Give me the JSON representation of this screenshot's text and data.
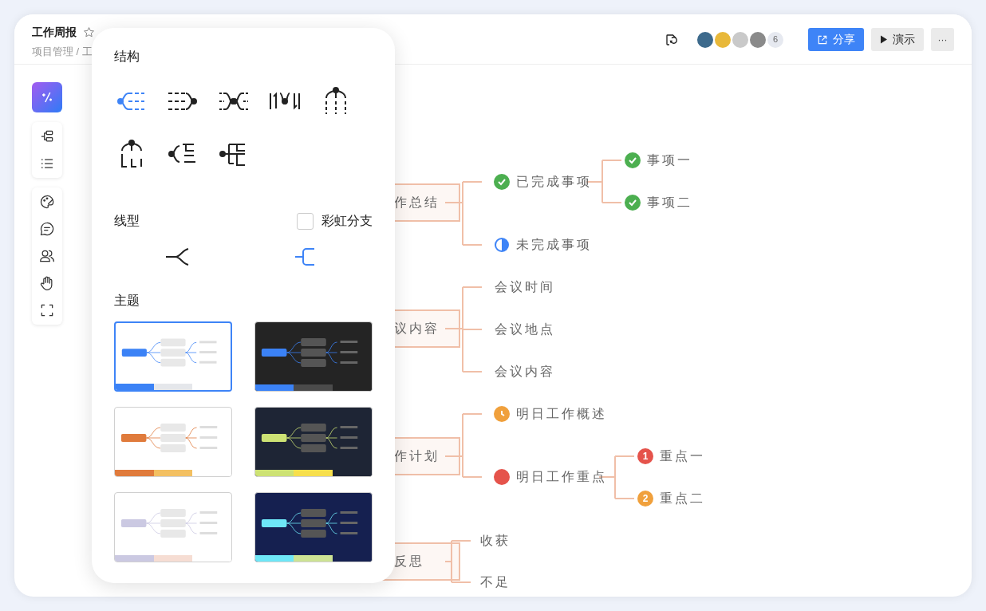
{
  "document": {
    "title": "工作周报",
    "breadcrumb": "项目管理 / 工"
  },
  "header": {
    "avatars": [
      {
        "color": "#3d6a8c"
      },
      {
        "color": "#e8b83a"
      },
      {
        "color": "#c9c9c9"
      },
      {
        "color": "#8a8a8a"
      }
    ],
    "member_count": "6",
    "share_button": "分享",
    "present_button": "演示",
    "more_button": "···"
  },
  "toolbar": {
    "groups": [
      [
        {
          "kind": "layout"
        },
        {
          "kind": "outline"
        }
      ],
      [
        {
          "kind": "style"
        },
        {
          "kind": "comment"
        },
        {
          "kind": "members"
        },
        {
          "kind": "hand"
        },
        {
          "kind": "fullscreen"
        }
      ]
    ]
  },
  "panel": {
    "structure_title": "结构",
    "structures": [
      {
        "kind": "left",
        "selected": true
      },
      {
        "kind": "right",
        "selected": false
      },
      {
        "kind": "both",
        "selected": false
      },
      {
        "kind": "numbered",
        "selected": false
      },
      {
        "kind": "down",
        "selected": false
      },
      {
        "kind": "org",
        "selected": false
      },
      {
        "kind": "left-tree",
        "selected": false
      },
      {
        "kind": "table",
        "selected": false
      }
    ],
    "line_title": "线型",
    "rainbow": {
      "label": "彩虹分支",
      "checked": false
    },
    "line_styles": [
      {
        "kind": "curve",
        "selected": false
      },
      {
        "kind": "bracket",
        "selected": true
      }
    ],
    "theme_title": "主题",
    "themes": [
      {
        "selected": true,
        "dark": false,
        "swatches": [
          {
            "color": "#3b82f6"
          },
          {
            "color": "#e5e7eb"
          },
          {
            "color": "#ffffff"
          }
        ]
      },
      {
        "selected": false,
        "dark": true,
        "swatches": [
          {
            "color": "#3b82f6"
          },
          {
            "color": "#4b4b4b"
          },
          {
            "color": "#242424"
          }
        ]
      },
      {
        "selected": false,
        "dark": false,
        "swatches": [
          {
            "color": "#e07b3c"
          },
          {
            "color": "#f3c062"
          },
          {
            "color": "#ffffff"
          }
        ]
      },
      {
        "selected": false,
        "dark": true,
        "swatches": [
          {
            "color": "#cde274"
          },
          {
            "color": "#f7df4c"
          },
          {
            "color": "#1e2535"
          }
        ]
      },
      {
        "selected": false,
        "dark": false,
        "swatches": [
          {
            "color": "#cbc9e2"
          },
          {
            "color": "#f6ddd3"
          },
          {
            "color": "#ffffff"
          }
        ]
      },
      {
        "selected": false,
        "dark": true,
        "swatches": [
          {
            "color": "#6ee7f7"
          },
          {
            "color": "#cde394"
          },
          {
            "color": "#152050"
          }
        ]
      }
    ]
  },
  "mindmap": {
    "topics": [
      {
        "label": "作总结",
        "children": [
          {
            "label": "已完成事项",
            "marker": {
              "kind": "done"
            },
            "children": [
              {
                "label": "事项一",
                "marker": {
                  "kind": "done"
                }
              },
              {
                "label": "事项二",
                "marker": {
                  "kind": "done"
                }
              }
            ]
          },
          {
            "label": "未完成事项",
            "marker": {
              "kind": "half"
            }
          }
        ]
      },
      {
        "label": "议内容",
        "children": [
          {
            "label": "会议时间"
          },
          {
            "label": "会议地点"
          },
          {
            "label": "会议内容"
          }
        ]
      },
      {
        "label": "作计划",
        "children": [
          {
            "label": "明日工作概述",
            "marker": {
              "kind": "clock",
              "color": "#f0a03c"
            }
          },
          {
            "label": "明日工作重点",
            "marker": {
              "kind": "dot",
              "color": "#e5534b"
            },
            "children": [
              {
                "label": "重点一",
                "marker": {
                  "kind": "number",
                  "text": "1",
                  "color": "#e5534b"
                }
              },
              {
                "label": "重点二",
                "marker": {
                  "kind": "number",
                  "text": "2",
                  "color": "#f0a03c"
                }
              }
            ]
          }
        ]
      },
      {
        "label": "反思",
        "children": [
          {
            "label": "收获"
          },
          {
            "label": "不足"
          }
        ]
      }
    ]
  }
}
